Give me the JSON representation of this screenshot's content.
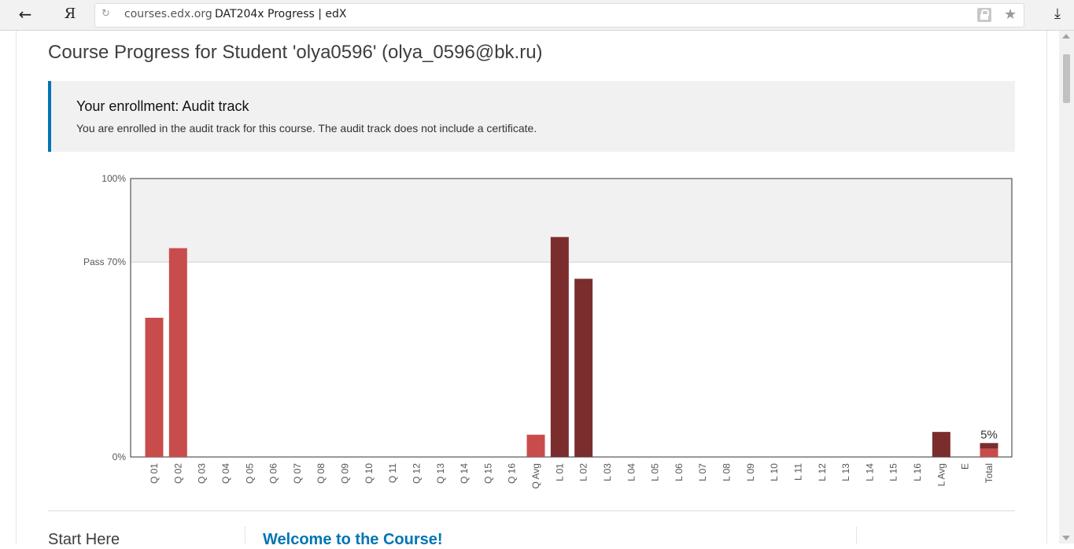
{
  "browser": {
    "back_icon": "arrow-left-icon",
    "yandex_logo": "Я",
    "reload_icon": "reload-icon",
    "domain": "courses.edx.org",
    "tab_title": "DAT204x Progress | edX",
    "lock_icon": "lock-icon",
    "star_icon": "star-icon",
    "download_icon": "download-icon"
  },
  "page": {
    "title": "Course Progress for Student 'olya0596' (olya_0596@bk.ru)",
    "enrollment": {
      "title": "Your enrollment: Audit track",
      "text": "You are enrolled in the audit track for this course. The audit track does not include a certificate."
    },
    "next_section": {
      "heading": "Start Here",
      "link": "Welcome to the Course!"
    }
  },
  "colors": {
    "quiz_bar": "#c94c4c",
    "lab_bar": "#7b2d2d",
    "pass_zone": "#f1f1f1",
    "accent": "#0075b4"
  },
  "chart_data": {
    "type": "bar",
    "ylim": [
      0,
      100
    ],
    "y_ticks": [
      {
        "label": "0%",
        "value": 0
      },
      {
        "label": "Pass 70%",
        "value": 70
      },
      {
        "label": "100%",
        "value": 100
      }
    ],
    "pass_threshold": 70,
    "total_label": "5%",
    "grid": false,
    "categories": [
      "Q 01",
      "Q 02",
      "Q 03",
      "Q 04",
      "Q 05",
      "Q 06",
      "Q 07",
      "Q 08",
      "Q 09",
      "Q 10",
      "Q 11",
      "Q 12",
      "Q 13",
      "Q 14",
      "Q 15",
      "Q 16",
      "Q Avg",
      "L 01",
      "L 02",
      "L 03",
      "L 04",
      "L 05",
      "L 06",
      "L 07",
      "L 08",
      "L 09",
      "L 10",
      "L 11",
      "L 12",
      "L 13",
      "L 14",
      "L 15",
      "L 16",
      "L Avg",
      "E",
      "Total"
    ],
    "bars": [
      {
        "category": "Q 01",
        "value": 50,
        "group": "quiz"
      },
      {
        "category": "Q 02",
        "value": 75,
        "group": "quiz"
      },
      {
        "category": "Q Avg",
        "value": 8,
        "group": "quiz"
      },
      {
        "category": "L 01",
        "value": 79,
        "group": "lab"
      },
      {
        "category": "L 02",
        "value": 64,
        "group": "lab"
      },
      {
        "category": "L Avg",
        "value": 9,
        "group": "lab"
      },
      {
        "category": "Total",
        "value": 3,
        "group": "quiz"
      },
      {
        "category": "Total",
        "value": 2,
        "group": "lab",
        "stack_on": 3
      }
    ]
  }
}
